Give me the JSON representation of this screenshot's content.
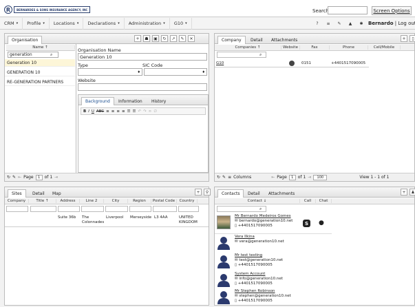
{
  "header": {
    "logo_text": "BERNARDES & SONS INSURANCE AGENCY, INC",
    "search_label": "Search:",
    "search_value": "",
    "screen_options": "Screen Options",
    "user": "Bernardo",
    "logout": "Log out",
    "separator": "|"
  },
  "menu": [
    {
      "label": "CRM",
      "caret": "▾"
    },
    {
      "label": "Profile",
      "caret": "▾"
    },
    {
      "label": "Locations",
      "caret": "▾"
    },
    {
      "label": "Declarations",
      "caret": "▾"
    },
    {
      "label": "Administration",
      "caret": "▾"
    },
    {
      "label": "G10",
      "caret": "▾"
    }
  ],
  "menu_icons": [
    "?",
    "≡",
    "✎",
    "▲",
    "✱"
  ],
  "organisation": {
    "tab": "Organisation",
    "col_name": "Name ↑",
    "filter_value": "generation",
    "rows": [
      "Generation 10",
      "GENERATION 10",
      "RE-GENERATION PARTNERS"
    ],
    "pager": {
      "page_label": "Page",
      "page": "1",
      "of": "of 1"
    },
    "form": {
      "org_name_label": "Organisation Name",
      "org_name_value": "Generation 10",
      "type_label": "Type",
      "sic_label": "SIC Code",
      "website_label": "Website",
      "website_value": "",
      "subtabs": [
        "Background",
        "Information",
        "History"
      ],
      "toolbar": [
        "B",
        "I",
        "U",
        "ABC",
        "≡",
        "≡",
        "≡",
        "≡",
        "☰",
        "☰",
        "↶",
        "↷",
        "∞",
        "∅"
      ]
    }
  },
  "company": {
    "tabs": [
      "Company",
      "Detail",
      "Attachments"
    ],
    "columns": [
      "Companies ↑",
      "Website",
      "Fax",
      "Phone",
      "Cell/Mobile"
    ],
    "row": {
      "name": "G10",
      "fax": "0151",
      "phone": "+4401517090005",
      "cell": ""
    },
    "pager": {
      "columns": "Columns",
      "page_label": "Page",
      "page": "1",
      "of": "of 1",
      "size": "100",
      "view": "View 1 - 1 of 1"
    }
  },
  "sites": {
    "tabs": [
      "Sites",
      "Detail",
      "Map"
    ],
    "columns": [
      "Company",
      "Title ↑",
      "Address",
      "Line 2",
      "City",
      "Region",
      "Postal Code",
      "Country"
    ],
    "row": {
      "address": "Suite 36b",
      "line2": "The Colonnades",
      "city": "Liverpool",
      "region": "Merseyside",
      "postal": "L3 4AA",
      "country": "UNITED KINGDOM"
    }
  },
  "contacts": {
    "tabs": [
      "Contacts",
      "Detail",
      "Attachments"
    ],
    "columns": [
      "Contact ↓",
      "Call",
      "Chat"
    ],
    "items": [
      {
        "name": "Mr Bernardo Medeiros Gomes",
        "email": "bernardo@generation10.net",
        "phone": "+4401517090005",
        "photo": true
      },
      {
        "name": "Vera Ilkina",
        "email": "vera@generation10.net",
        "phone": "",
        "photo": false
      },
      {
        "name": "Mr test testing",
        "email": "test@generation10.net",
        "phone": "+4401517090005",
        "photo": false
      },
      {
        "name": "System Account",
        "email": "info@generation10.net",
        "phone": "+4401517090005",
        "photo": false
      },
      {
        "name": "Mr Stephen Robinson",
        "email": "stephen@generation10.net",
        "phone": "+4401517090005",
        "photo": false
      }
    ]
  },
  "colors": {
    "accent": "#2a3f6e",
    "link": "#222222",
    "selected_row": "#fdf6d8"
  }
}
